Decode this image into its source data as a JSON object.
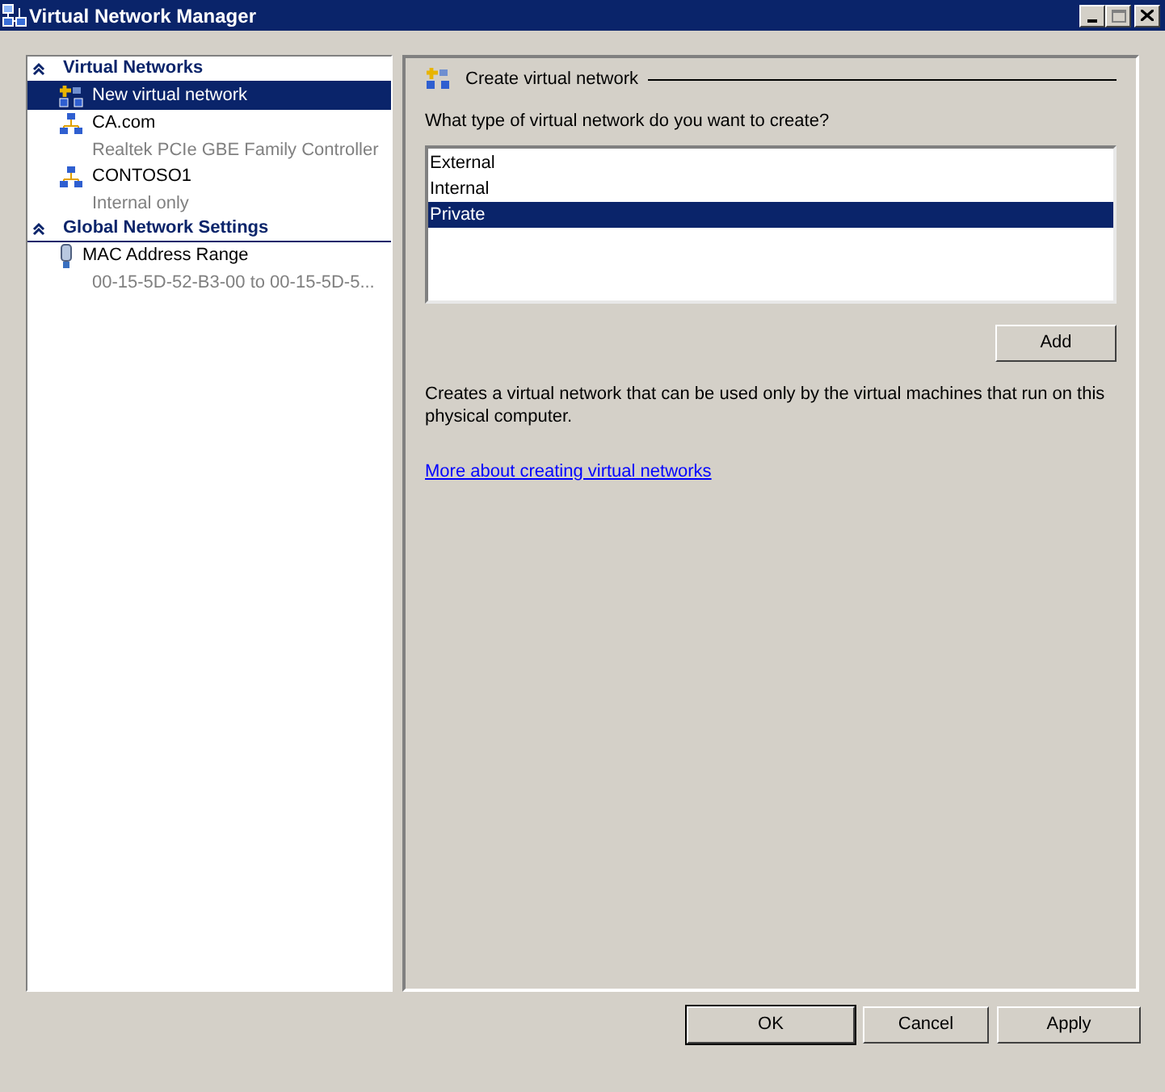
{
  "window": {
    "title": "Virtual Network Manager"
  },
  "sidebar": {
    "sections": [
      {
        "title": "Virtual Networks",
        "expanded": true,
        "items": [
          {
            "kind": "new",
            "name": "New virtual network",
            "selected": true
          },
          {
            "kind": "network",
            "name": "CA.com",
            "detail": "Realtek PCIe GBE Family Controller",
            "selected": false
          },
          {
            "kind": "network",
            "name": "CONTOSO1",
            "detail": "Internal only",
            "selected": false
          }
        ]
      },
      {
        "title": "Global Network Settings",
        "expanded": true,
        "items": [
          {
            "kind": "mac",
            "name": "MAC Address Range",
            "detail": "00-15-5D-52-B3-00 to 00-15-5D-5...",
            "selected": false
          }
        ]
      }
    ]
  },
  "panel": {
    "title": "Create virtual network",
    "question": "What type of virtual network do you want to create?",
    "types": [
      {
        "label": "External",
        "selected": false
      },
      {
        "label": "Internal",
        "selected": false
      },
      {
        "label": "Private",
        "selected": true
      }
    ],
    "add_button": "Add",
    "description": "Creates a virtual network that can be used only by the virtual machines that run on this physical computer.",
    "link": "More about creating virtual networks"
  },
  "buttons": [
    {
      "label": "OK"
    },
    {
      "label": "Cancel"
    },
    {
      "label": "Apply"
    }
  ]
}
